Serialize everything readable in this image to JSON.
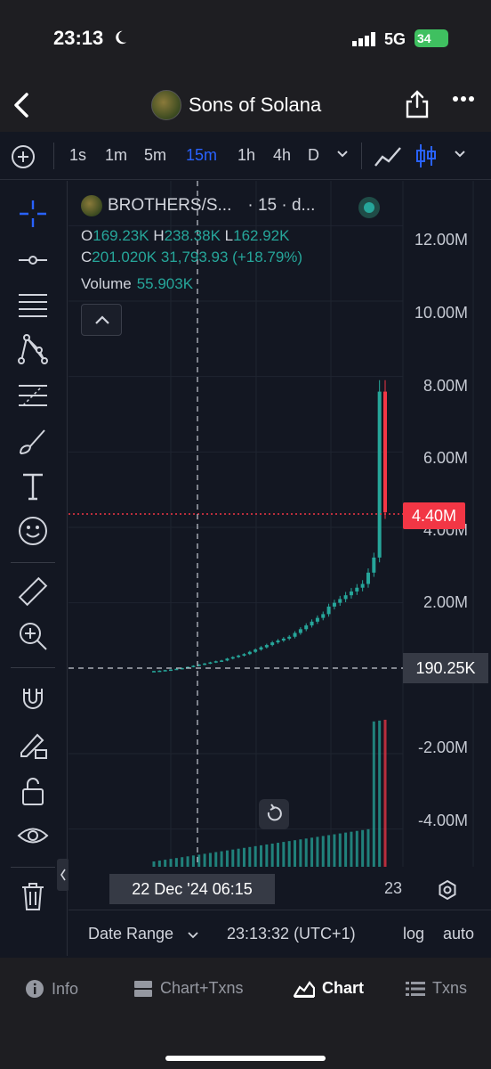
{
  "status": {
    "time": "23:13",
    "network": "5G",
    "battery": "34"
  },
  "header": {
    "title": "Sons of Solana"
  },
  "timeframes": [
    "1s",
    "1m",
    "5m",
    "15m",
    "1h",
    "4h",
    "D"
  ],
  "active_timeframe": "15m",
  "legend": {
    "pair": "BROTHERS/S...",
    "interval": "· 15 · d...",
    "o_label": "O",
    "o": "169.23K",
    "h_label": "H",
    "h": "238.38K",
    "l_label": "L",
    "l": "162.92K",
    "c_label": "C",
    "c": "201.020K",
    "change": "31,793.93 (+18.79%)",
    "volume_label": "Volume",
    "volume": "55.903K"
  },
  "y_axis": [
    "12.00M",
    "10.00M",
    "8.00M",
    "6.00M",
    "4.00M",
    "2.00M",
    "-2.00M",
    "-4.00M"
  ],
  "last_price_tag": "4.40M",
  "crosshair_price": "190.25K",
  "crosshair_time": "22 Dec '24   06:15",
  "x_axis_label": "23",
  "bottom_bar": {
    "date_range": "Date Range",
    "clock": "23:13:32 (UTC+1)",
    "log": "log",
    "auto": "auto"
  },
  "nav": [
    {
      "label": "Info",
      "icon": "info-icon"
    },
    {
      "label": "Chart+Txns",
      "icon": "chart-txns-icon"
    },
    {
      "label": "Chart",
      "icon": "area-chart-icon"
    },
    {
      "label": "Txns",
      "icon": "list-icon"
    }
  ],
  "active_nav": "Chart",
  "colors": {
    "up": "#26a69a",
    "down": "#f23645",
    "accent": "#2962ff",
    "background": "#131722"
  },
  "chart_data": {
    "type": "candlestick",
    "symbol": "BROTHERS/S...",
    "interval": "15",
    "ylim": [
      -5000000,
      13000000
    ],
    "y_ticks": [
      12000000,
      10000000,
      8000000,
      6000000,
      4000000,
      2000000,
      -2000000,
      -4000000
    ],
    "last_price": 4400000,
    "crosshair": {
      "price": 190250
    },
    "close_series": [
      190000,
      200000,
      215000,
      230000,
      250000,
      270000,
      300000,
      330000,
      360000,
      390000,
      420000,
      450000,
      470000,
      520000,
      560000,
      600000,
      640000,
      700000,
      760000,
      820000,
      880000,
      950000,
      1000000,
      1050000,
      1100000,
      1200000,
      1300000,
      1400000,
      1500000,
      1600000,
      1700000,
      1900000,
      2000000,
      2100000,
      2200000,
      2300000,
      2400000,
      2500000,
      2800000,
      3200000,
      7600000,
      4400000
    ]
  }
}
